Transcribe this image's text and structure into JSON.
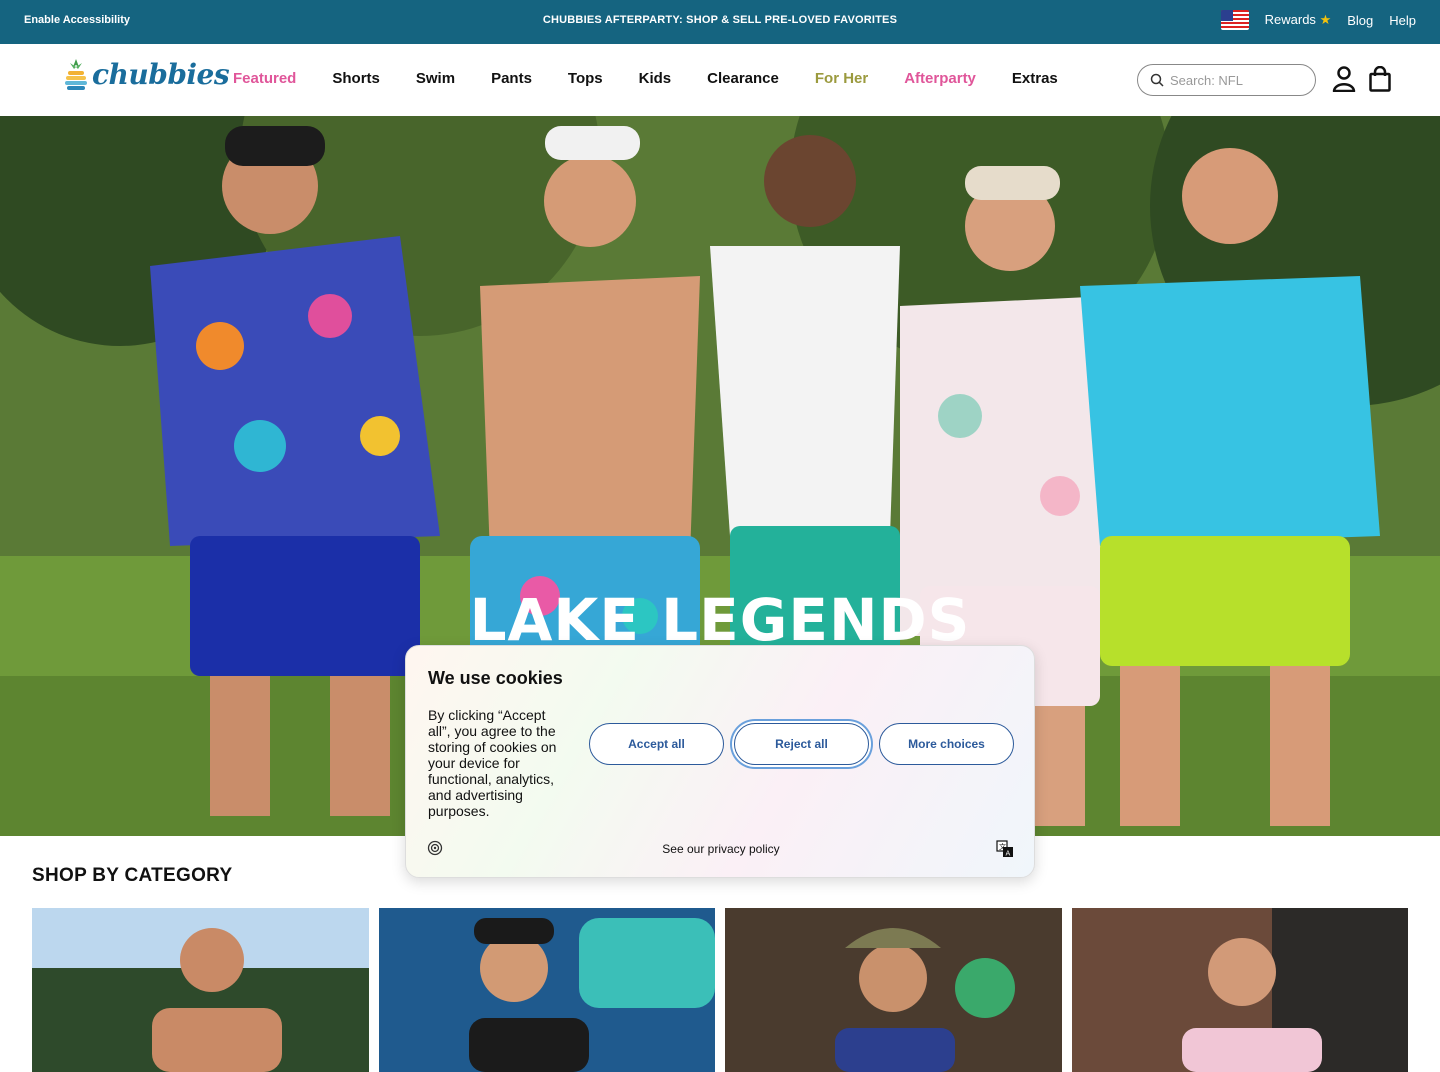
{
  "topbar": {
    "accessibility": "Enable Accessibility",
    "promo": "CHUBBIES AFTERPARTY: SHOP & SELL PRE-LOVED FAVORITES",
    "rewards": "Rewards",
    "blog": "Blog",
    "help": "Help"
  },
  "brand": {
    "name": "chubbies"
  },
  "nav": {
    "items": [
      {
        "label": "Featured"
      },
      {
        "label": "Shorts"
      },
      {
        "label": "Swim"
      },
      {
        "label": "Pants"
      },
      {
        "label": "Tops"
      },
      {
        "label": "Kids"
      },
      {
        "label": "Clearance"
      },
      {
        "label": "For Her"
      },
      {
        "label": "Afterparty"
      },
      {
        "label": "Extras"
      }
    ]
  },
  "search": {
    "placeholder": "Search: NFL"
  },
  "hero": {
    "title": "LAKE LEGENDS"
  },
  "category": {
    "title": "SHOP BY CATEGORY"
  },
  "cookie": {
    "title": "We use cookies",
    "body": "By clicking “Accept all”, you agree to the storing of cookies on your device for functional, analytics, and advertising purposes.",
    "accept": "Accept all",
    "reject": "Reject all",
    "more": "More choices",
    "policy": "See our privacy policy"
  },
  "colors": {
    "topbar": "#156480",
    "accent_pink": "#e0569a",
    "accent_olive": "#9b9a3e",
    "button_blue": "#2c5a9b"
  }
}
